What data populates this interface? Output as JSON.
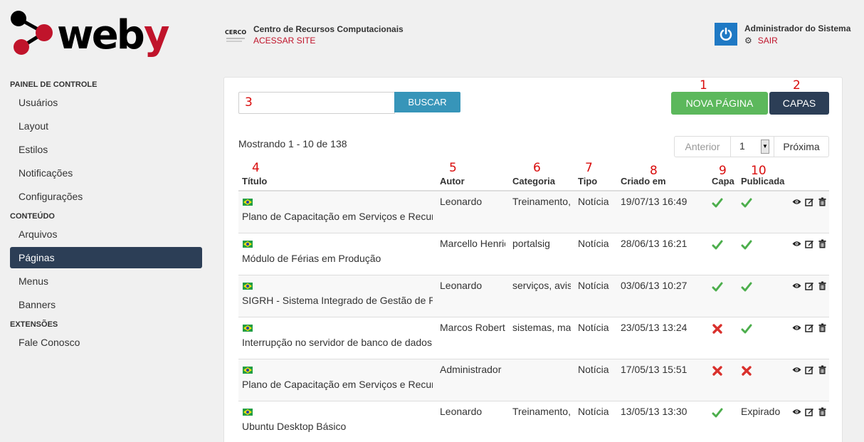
{
  "logo": {
    "text": "weby"
  },
  "header": {
    "org_name": "Centro de Recursos Computacionais",
    "org_link": "ACESSAR SITE",
    "org_logo_text": "CERCOMP"
  },
  "user": {
    "name": "Administrador do Sistema",
    "logout": "SAIR"
  },
  "sidebar": {
    "sections": [
      {
        "title": "PAINEL DE CONTROLE",
        "items": [
          "Usuários",
          "Layout",
          "Estilos",
          "Notificações",
          "Configurações"
        ]
      },
      {
        "title": "CONTEÚDO",
        "items": [
          "Arquivos",
          "Páginas",
          "Menus",
          "Banners"
        ]
      },
      {
        "title": "EXTENSÕES",
        "items": [
          "Fale Conosco"
        ]
      }
    ],
    "active": "Páginas"
  },
  "toolbar": {
    "search_button": "BUSCAR",
    "new_page_button": "NOVA PÁGINA",
    "covers_button": "CAPAS"
  },
  "annotations": [
    "1",
    "2",
    "3",
    "4",
    "5",
    "6",
    "7",
    "8",
    "9",
    "10"
  ],
  "listing": {
    "showing": "Mostrando 1 - 10 de 138",
    "pager": {
      "prev": "Anterior",
      "page": "1",
      "next": "Próxima"
    }
  },
  "table": {
    "headers": [
      "Título",
      "Autor",
      "Categoria",
      "Tipo",
      "Criado em",
      "Capa",
      "Publicada"
    ],
    "rows": [
      {
        "title": "Plano de Capacitação em Serviços e Recursos",
        "author": "Leonardo",
        "category": "Treinamento, capacitação",
        "type": "Notícia",
        "created": "19/07/13 16:49",
        "cover": "yes",
        "published": "yes"
      },
      {
        "title": "Módulo de Férias em Produção",
        "author": "Marcello Henrique",
        "category": "portalsig",
        "type": "Notícia",
        "created": "28/06/13 16:21",
        "cover": "yes",
        "published": "yes"
      },
      {
        "title": "SIGRH - Sistema Integrado de Gestão de Recursos Humanos",
        "author": "Leonardo",
        "category": "serviços, avisos",
        "type": "Notícia",
        "created": "03/06/13 10:27",
        "cover": "yes",
        "published": "yes"
      },
      {
        "title": "Interrupção no servidor de banco de dados",
        "author": "Marcos Roberto",
        "category": "sistemas, manutenção",
        "type": "Notícia",
        "created": "23/05/13 13:24",
        "cover": "no",
        "published": "yes"
      },
      {
        "title": "Plano de Capacitação em Serviços e Recursos",
        "author": "Administrador",
        "category": "",
        "type": "Notícia",
        "created": "17/05/13 15:51",
        "cover": "no",
        "published": "no"
      },
      {
        "title": "Ubuntu Desktop Básico",
        "author": "Leonardo",
        "category": "Treinamento, capacitação",
        "type": "Notícia",
        "created": "13/05/13 13:30",
        "cover": "yes",
        "published": "Expirado"
      }
    ]
  },
  "colors": {
    "accent_red": "#c0142b",
    "navy": "#2c3e56",
    "green": "#5cb85c",
    "blue": "#3795b9",
    "annotation": "#d90d0d"
  }
}
